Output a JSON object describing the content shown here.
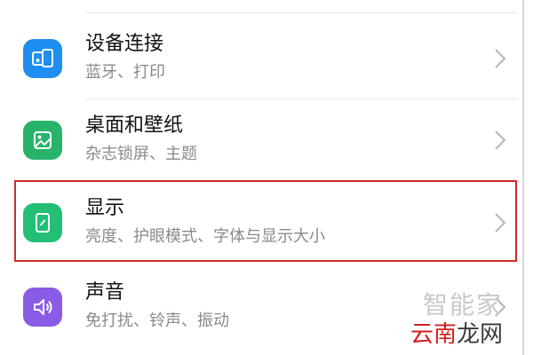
{
  "settings_list": [
    {
      "title": "设备连接",
      "subtitle": "蓝牙、打印",
      "icon": "device-connection-icon",
      "color": "#1f8ef1"
    },
    {
      "title": "桌面和壁纸",
      "subtitle": "杂志锁屏、主题",
      "icon": "wallpaper-icon",
      "color": "#27b36a"
    },
    {
      "title": "显示",
      "subtitle": "亮度、护眼模式、字体与显示大小",
      "icon": "display-icon",
      "color": "#22bf75"
    },
    {
      "title": "声音",
      "subtitle": "免打扰、铃声、振动",
      "icon": "sound-icon",
      "color": "#8a5ce6"
    }
  ],
  "highlight": {
    "color": "#cf2a2a"
  },
  "watermark": {
    "line1": "智能家",
    "line2_part1": "云南",
    "line2_part2": "龙网"
  }
}
